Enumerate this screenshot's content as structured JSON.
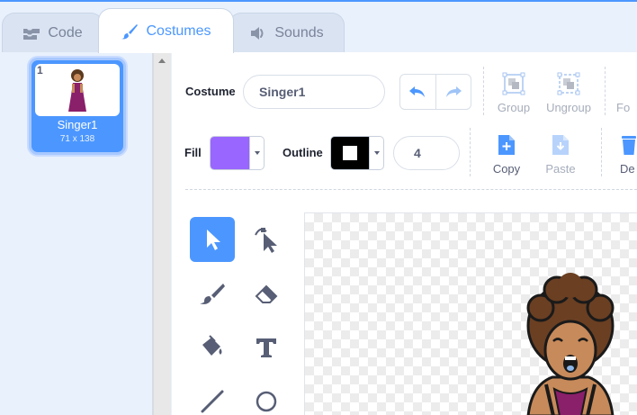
{
  "tabs": {
    "code": "Code",
    "costumes": "Costumes",
    "sounds": "Sounds"
  },
  "costume_list": {
    "items": [
      {
        "number": "1",
        "name": "Singer1",
        "size": "71 x 138"
      }
    ]
  },
  "toolbar": {
    "costume_label": "Costume",
    "costume_name": "Singer1",
    "group_label": "Group",
    "ungroup_label": "Ungroup",
    "forward_label": "Fo",
    "fill_label": "Fill",
    "outline_label": "Outline",
    "outline_width": "4",
    "copy_label": "Copy",
    "paste_label": "Paste",
    "delete_label": "De"
  },
  "colors": {
    "accent": "#4c97ff",
    "fill": "#9966ff",
    "outline": "#000000"
  },
  "paint_tools": [
    "select-tool",
    "reshape-tool",
    "brush-tool",
    "eraser-tool",
    "fill-tool",
    "text-tool",
    "line-tool",
    "circle-tool"
  ]
}
